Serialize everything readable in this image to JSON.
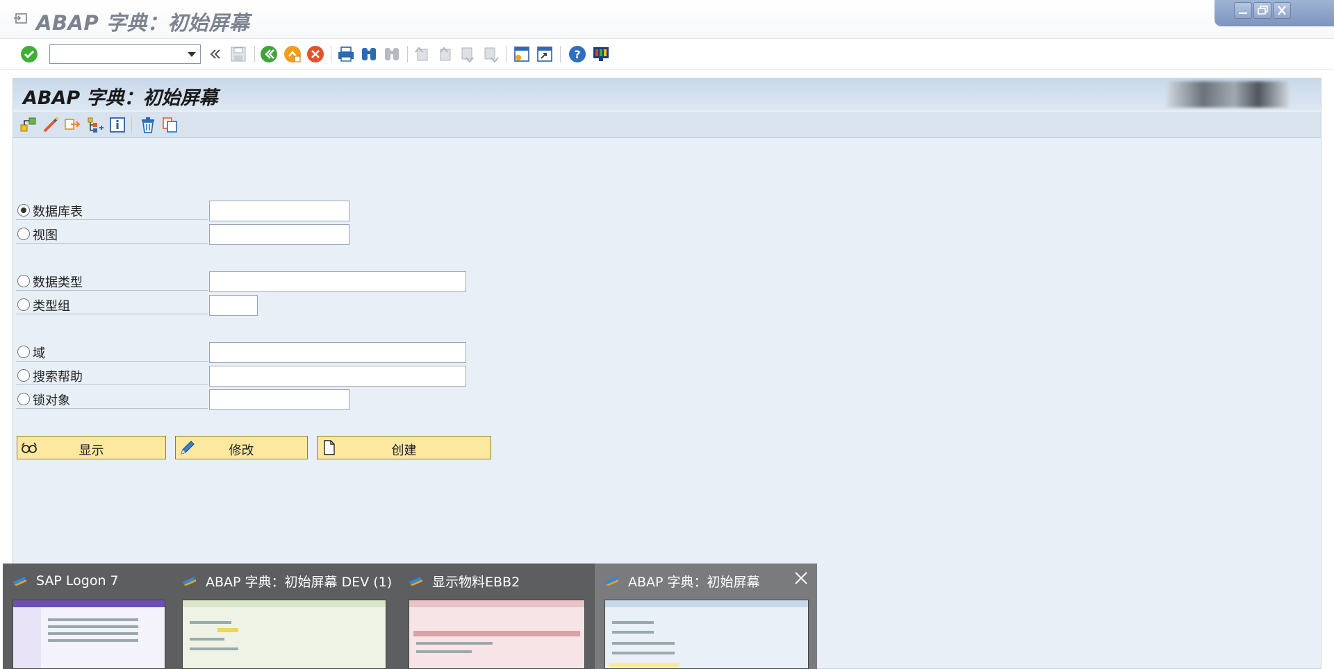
{
  "window": {
    "title": "ABAP 字典：初始屏幕",
    "controls": [
      "minimize",
      "restore",
      "close"
    ]
  },
  "toolbar": {
    "command_field_value": "",
    "icons": [
      "enter-check-icon",
      "double-left-icon",
      "save-icon",
      "back-icon",
      "exit-icon",
      "cancel-icon",
      "print-icon",
      "find-icon",
      "find-next-icon",
      "first-page-icon",
      "previous-page-icon",
      "next-page-icon",
      "last-page-icon",
      "new-session-icon",
      "shortcut-icon",
      "help-icon",
      "customize-layout-icon"
    ]
  },
  "page": {
    "title": "ABAP 字典：初始屏幕",
    "app_toolbar_icons": [
      "other-object-icon",
      "check-icon",
      "activate-icon",
      "hierarchy-icon",
      "info-icon",
      "delete-icon",
      "copy-icon"
    ]
  },
  "form": {
    "options": [
      {
        "label": "数据库表",
        "selected": true,
        "value": ""
      },
      {
        "label": "视图",
        "selected": false,
        "value": ""
      },
      {
        "label": "数据类型",
        "selected": false,
        "value": ""
      },
      {
        "label": "类型组",
        "selected": false,
        "value": ""
      },
      {
        "label": "域",
        "selected": false,
        "value": ""
      },
      {
        "label": "搜索帮助",
        "selected": false,
        "value": ""
      },
      {
        "label": "锁对象",
        "selected": false,
        "value": ""
      }
    ],
    "buttons": {
      "display": "显示",
      "change": "修改",
      "create": "创建"
    }
  },
  "taskbar": {
    "items": [
      {
        "title": "SAP Logon 7"
      },
      {
        "title": "ABAP 字典：初始屏幕 DEV (1)"
      },
      {
        "title": "显示物料EBB2"
      },
      {
        "title": "ABAP 字典：初始屏幕"
      }
    ]
  },
  "colors": {
    "button_fill": "#fce99f",
    "content_bg": "#e9eff6",
    "header_bg": "#c8d8eb"
  }
}
